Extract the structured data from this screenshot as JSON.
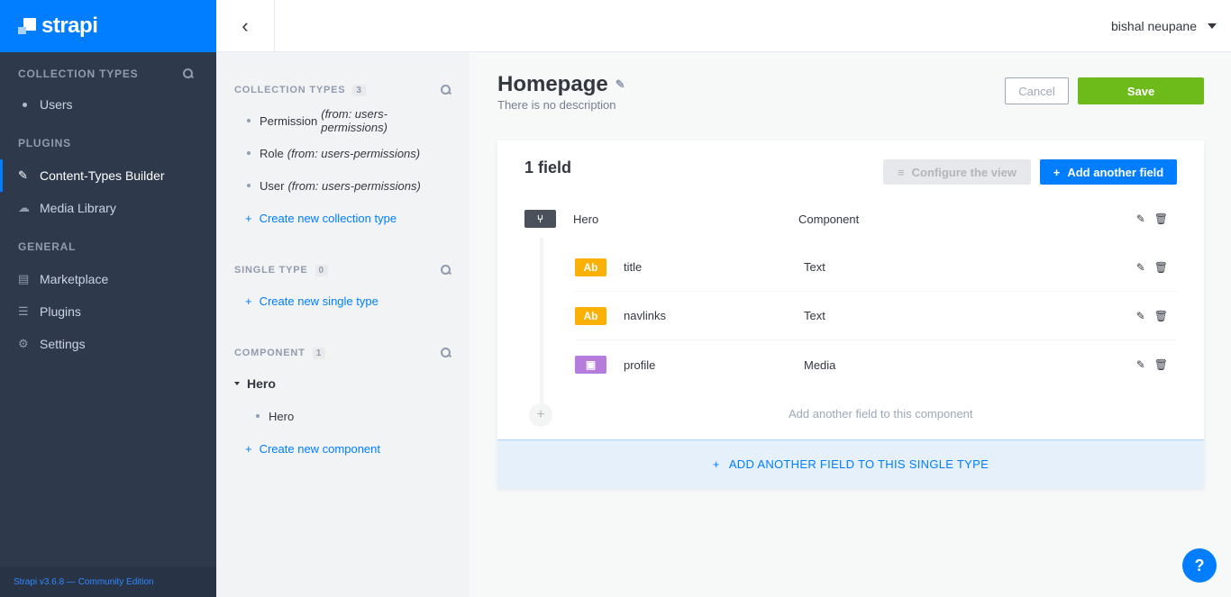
{
  "brand": {
    "name": "strapi"
  },
  "leftnav": {
    "collection_types": {
      "title": "COLLECTION TYPES",
      "items": [
        {
          "label": "Users"
        }
      ]
    },
    "plugins": {
      "title": "PLUGINS",
      "items": [
        {
          "label": "Content-Types Builder",
          "icon": "paintbrush-icon"
        },
        {
          "label": "Media Library",
          "icon": "cloud-upload-icon"
        }
      ]
    },
    "general": {
      "title": "GENERAL",
      "items": [
        {
          "label": "Marketplace",
          "icon": "shopping-basket-icon"
        },
        {
          "label": "Plugins",
          "icon": "list-icon"
        },
        {
          "label": "Settings",
          "icon": "cog-icon"
        }
      ]
    },
    "footer": "Strapi v3.6.8 — Community Edition"
  },
  "header": {
    "user_name": "bishal neupane"
  },
  "subnav": {
    "collection_types": {
      "title": "COLLECTION TYPES",
      "count": "3",
      "items": [
        {
          "label": "Permission",
          "from": "(from: users-permissions)"
        },
        {
          "label": "Role",
          "from": "(from: users-permissions)"
        },
        {
          "label": "User",
          "from": "(from: users-permissions)"
        }
      ],
      "create_label": "Create new collection type"
    },
    "single_type": {
      "title": "SINGLE TYPE",
      "count": "0",
      "create_label": "Create new single type"
    },
    "component": {
      "title": "COMPONENT",
      "count": "1",
      "group": "Hero",
      "items": [
        {
          "label": "Hero"
        }
      ],
      "create_label": "Create new component"
    }
  },
  "main": {
    "title": "Homepage",
    "description": "There is no description",
    "cancel_label": "Cancel",
    "save_label": "Save",
    "card": {
      "title": "1 field",
      "configure_label": "Configure the view",
      "add_label": "Add another field",
      "fields": [
        {
          "name": "Hero",
          "type": "Component"
        },
        {
          "name": "title",
          "type": "Text"
        },
        {
          "name": "navlinks",
          "type": "Text"
        },
        {
          "name": "profile",
          "type": "Media"
        }
      ],
      "add_component_field_label": "Add another field to this component",
      "add_single_label": "ADD ANOTHER FIELD TO THIS SINGLE TYPE"
    },
    "help_label": "?"
  },
  "colors": {
    "accent": "#007eff",
    "save": "#6dbb1a",
    "text_badge": "#fab005",
    "media_badge": "#b57cdb",
    "component_badge": "#333740"
  }
}
